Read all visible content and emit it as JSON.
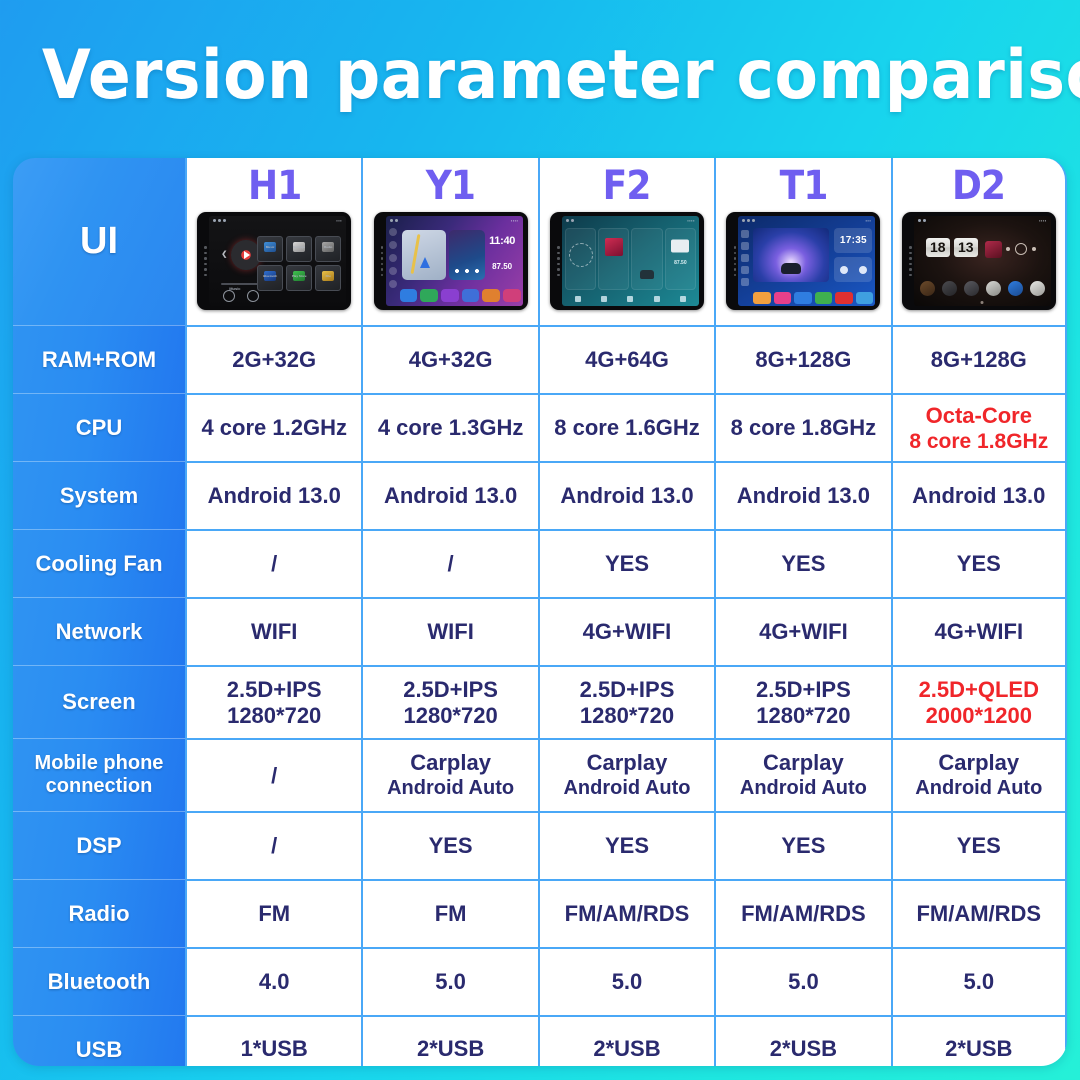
{
  "header": {
    "title": "Version parameter comparison"
  },
  "table": {
    "corner_label": "UI",
    "models": [
      "H1",
      "Y1",
      "F2",
      "T1",
      "D2"
    ],
    "device_screens": [
      {
        "model": "H1",
        "theme": "dark-black",
        "tiles": [
          "Music",
          "Settings",
          "Radio",
          "Bluetooth",
          "Play Store",
          "File"
        ]
      },
      {
        "model": "Y1",
        "theme": "purple-gradient",
        "clock": "11:40",
        "radio_freq": "87.50"
      },
      {
        "model": "F2",
        "theme": "teal-cyan",
        "radio_freq": "87.50"
      },
      {
        "model": "T1",
        "theme": "blue",
        "clock": "17:35"
      },
      {
        "model": "D2",
        "theme": "dark-brown",
        "clock_hour": "18",
        "clock_minute": "13"
      }
    ],
    "rows": [
      {
        "label": "RAM+ROM",
        "cells": [
          {
            "lines": [
              "2G+32G"
            ],
            "highlight": false
          },
          {
            "lines": [
              "4G+32G"
            ],
            "highlight": false
          },
          {
            "lines": [
              "4G+64G"
            ],
            "highlight": false
          },
          {
            "lines": [
              "8G+128G"
            ],
            "highlight": false
          },
          {
            "lines": [
              "8G+128G"
            ],
            "highlight": false
          }
        ]
      },
      {
        "label": "CPU",
        "cells": [
          {
            "lines": [
              "4 core 1.2GHz"
            ],
            "highlight": false
          },
          {
            "lines": [
              "4 core 1.3GHz"
            ],
            "highlight": false
          },
          {
            "lines": [
              "8 core 1.6GHz"
            ],
            "highlight": false
          },
          {
            "lines": [
              "8 core 1.8GHz"
            ],
            "highlight": false
          },
          {
            "lines": [
              "Octa-Core",
              "8 core 1.8GHz"
            ],
            "highlight": true
          }
        ]
      },
      {
        "label": "System",
        "cells": [
          {
            "lines": [
              "Android 13.0"
            ],
            "highlight": false
          },
          {
            "lines": [
              "Android 13.0"
            ],
            "highlight": false
          },
          {
            "lines": [
              "Android 13.0"
            ],
            "highlight": false
          },
          {
            "lines": [
              "Android 13.0"
            ],
            "highlight": false
          },
          {
            "lines": [
              "Android 13.0"
            ],
            "highlight": false
          }
        ]
      },
      {
        "label": "Cooling Fan",
        "cells": [
          {
            "lines": [
              "/"
            ],
            "highlight": false
          },
          {
            "lines": [
              "/"
            ],
            "highlight": false
          },
          {
            "lines": [
              "YES"
            ],
            "highlight": false
          },
          {
            "lines": [
              "YES"
            ],
            "highlight": false
          },
          {
            "lines": [
              "YES"
            ],
            "highlight": false
          }
        ]
      },
      {
        "label": "Network",
        "cells": [
          {
            "lines": [
              "WIFI"
            ],
            "highlight": false
          },
          {
            "lines": [
              "WIFI"
            ],
            "highlight": false
          },
          {
            "lines": [
              "4G+WIFI"
            ],
            "highlight": false
          },
          {
            "lines": [
              "4G+WIFI"
            ],
            "highlight": false
          },
          {
            "lines": [
              "4G+WIFI"
            ],
            "highlight": false
          }
        ]
      },
      {
        "label": "Screen",
        "cells": [
          {
            "lines": [
              "2.5D+IPS",
              "1280*720"
            ],
            "highlight": false
          },
          {
            "lines": [
              "2.5D+IPS",
              "1280*720"
            ],
            "highlight": false
          },
          {
            "lines": [
              "2.5D+IPS",
              "1280*720"
            ],
            "highlight": false
          },
          {
            "lines": [
              "2.5D+IPS",
              "1280*720"
            ],
            "highlight": false
          },
          {
            "lines": [
              "2.5D+QLED",
              "2000*1200"
            ],
            "highlight": true
          }
        ]
      },
      {
        "label": "Mobile phone connection",
        "cells": [
          {
            "lines": [
              "/"
            ],
            "highlight": false
          },
          {
            "lines": [
              "Carplay",
              "Android Auto"
            ],
            "highlight": false
          },
          {
            "lines": [
              "Carplay",
              "Android Auto"
            ],
            "highlight": false
          },
          {
            "lines": [
              "Carplay",
              "Android Auto"
            ],
            "highlight": false
          },
          {
            "lines": [
              "Carplay",
              "Android Auto"
            ],
            "highlight": false
          }
        ]
      },
      {
        "label": "DSP",
        "cells": [
          {
            "lines": [
              "/"
            ],
            "highlight": false
          },
          {
            "lines": [
              "YES"
            ],
            "highlight": false
          },
          {
            "lines": [
              "YES"
            ],
            "highlight": false
          },
          {
            "lines": [
              "YES"
            ],
            "highlight": false
          },
          {
            "lines": [
              "YES"
            ],
            "highlight": false
          }
        ]
      },
      {
        "label": "Radio",
        "cells": [
          {
            "lines": [
              "FM"
            ],
            "highlight": false
          },
          {
            "lines": [
              "FM"
            ],
            "highlight": false
          },
          {
            "lines": [
              "FM/AM/RDS"
            ],
            "highlight": false
          },
          {
            "lines": [
              "FM/AM/RDS"
            ],
            "highlight": false
          },
          {
            "lines": [
              "FM/AM/RDS"
            ],
            "highlight": false
          }
        ]
      },
      {
        "label": "Bluetooth",
        "cells": [
          {
            "lines": [
              "4.0"
            ],
            "highlight": false
          },
          {
            "lines": [
              "5.0"
            ],
            "highlight": false
          },
          {
            "lines": [
              "5.0"
            ],
            "highlight": false
          },
          {
            "lines": [
              "5.0"
            ],
            "highlight": false
          },
          {
            "lines": [
              "5.0"
            ],
            "highlight": false
          }
        ]
      },
      {
        "label": "USB",
        "cells": [
          {
            "lines": [
              "1*USB"
            ],
            "highlight": false
          },
          {
            "lines": [
              "2*USB"
            ],
            "highlight": false
          },
          {
            "lines": [
              "2*USB"
            ],
            "highlight": false
          },
          {
            "lines": [
              "2*USB"
            ],
            "highlight": false
          },
          {
            "lines": [
              "2*USB"
            ],
            "highlight": false
          }
        ]
      }
    ]
  },
  "colors": {
    "background_start": "#1f9cf0",
    "background_end": "#25f0d8",
    "sidebar_blue": "#2a8cf2",
    "model_purple": "#6f5ef0",
    "cell_text": "#2a2a6e",
    "highlight_red": "#f0262a",
    "grid_line": "#4aa8f7"
  }
}
